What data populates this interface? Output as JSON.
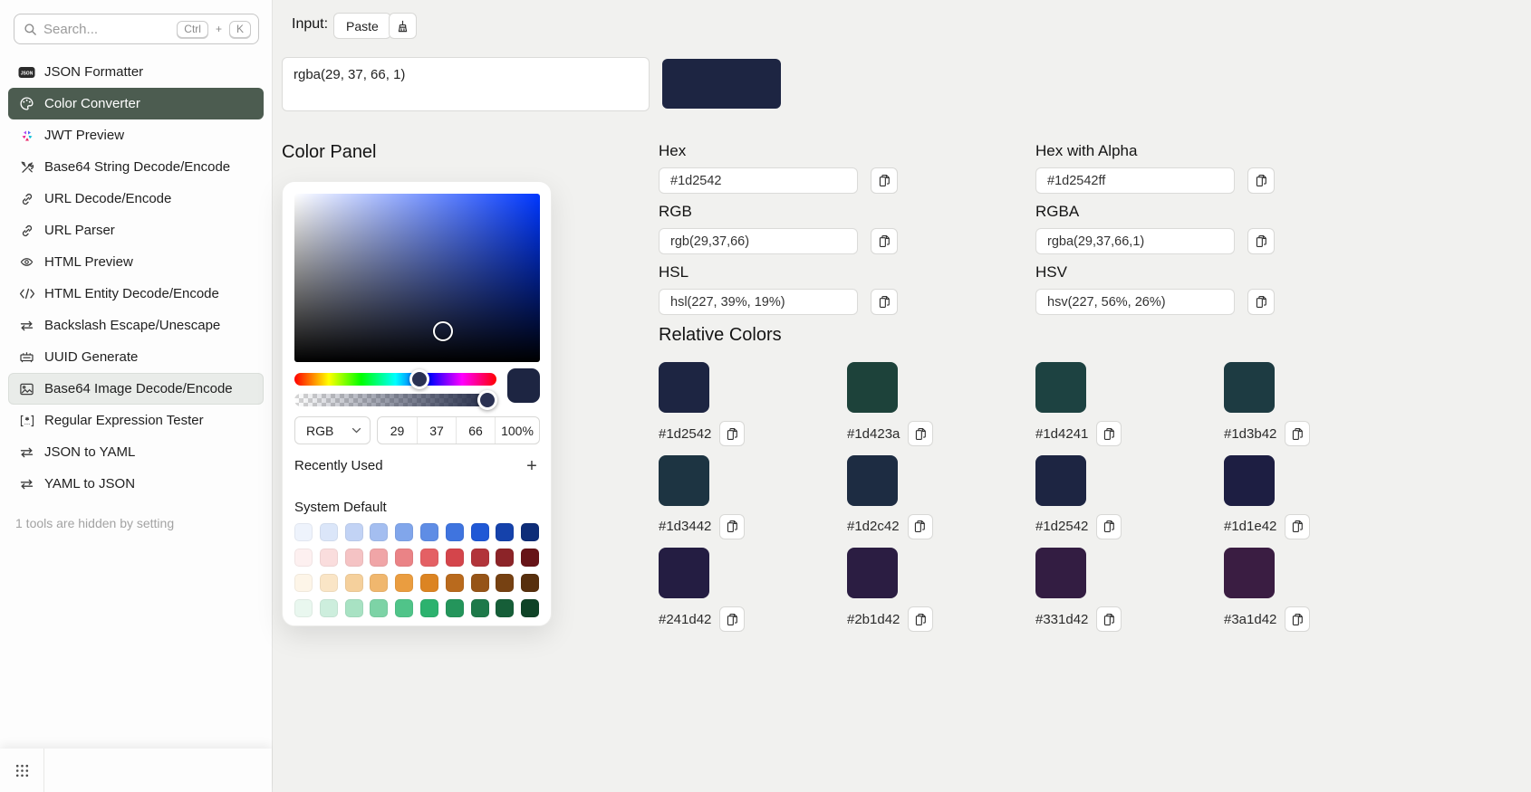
{
  "sidebar": {
    "search": {
      "placeholder": "Search...",
      "shortcut": {
        "key1": "Ctrl",
        "joiner": "+",
        "key2": "K"
      },
      "icon": "search-icon"
    },
    "items": [
      {
        "label": "JSON Formatter",
        "icon": "json-badge-icon",
        "state": "normal"
      },
      {
        "label": "Color Converter",
        "icon": "palette-icon",
        "state": "selected"
      },
      {
        "label": "JWT Preview",
        "icon": "jwt-pinwheel-icon",
        "state": "normal"
      },
      {
        "label": "Base64 String Decode/Encode",
        "icon": "hammer-wrench-icon",
        "state": "normal"
      },
      {
        "label": "URL Decode/Encode",
        "icon": "link-icon",
        "state": "normal"
      },
      {
        "label": "URL Parser",
        "icon": "link-icon",
        "state": "normal"
      },
      {
        "label": "HTML Preview",
        "icon": "eye-icon",
        "state": "normal"
      },
      {
        "label": "HTML Entity Decode/Encode",
        "icon": "code-brackets-icon",
        "state": "normal"
      },
      {
        "label": "Backslash Escape/Unescape",
        "icon": "swap-arrows-icon",
        "state": "normal"
      },
      {
        "label": "UUID Generate",
        "icon": "uuid-icon",
        "state": "normal"
      },
      {
        "label": "Base64 Image Decode/Encode",
        "icon": "image-icon",
        "state": "hover"
      },
      {
        "label": "Regular Expression Tester",
        "icon": "regex-icon",
        "state": "normal"
      },
      {
        "label": "JSON to YAML",
        "icon": "swap-arrows-icon",
        "state": "normal"
      },
      {
        "label": "YAML to JSON",
        "icon": "swap-arrows-icon",
        "state": "normal"
      }
    ],
    "hidden_note": "1 tools are hidden by setting",
    "footer_icon": "apps-grid-icon"
  },
  "main": {
    "input_bar": {
      "label": "Input:",
      "paste_label": "Paste",
      "clear_icon": "broom-icon"
    },
    "input_value": "rgba(29, 37, 66, 1)",
    "preview_color": "#1d2542",
    "color_panel": {
      "title": "Color Panel",
      "hue_color": "#0037ff",
      "thumb_color": "#2a3152",
      "format": "RGB",
      "channels": {
        "r": "29",
        "g": "37",
        "b": "66",
        "alpha": "100%"
      },
      "recently_used_label": "Recently Used",
      "add_label": "+",
      "system_default_label": "System Default",
      "palette": [
        [
          "#eef3fc",
          "#dbe6f9",
          "#c2d3f5",
          "#a4bef0",
          "#81a6eb",
          "#5f8de5",
          "#3f74df",
          "#2058d5",
          "#1542ab",
          "#0e2d78"
        ],
        [
          "#fdf0f0",
          "#fadddd",
          "#f5c3c4",
          "#f0a5a7",
          "#ea8386",
          "#e46064",
          "#d4454b",
          "#b2343a",
          "#8c2428",
          "#671418"
        ],
        [
          "#fdf5e8",
          "#fae5c6",
          "#f5d09c",
          "#f0b76e",
          "#ea9d40",
          "#dc8422",
          "#b96a1d",
          "#965417",
          "#764112",
          "#572f0d"
        ],
        [
          "#e9f7ef",
          "#cdeedd",
          "#a8e2c3",
          "#7dd3a6",
          "#50c489",
          "#2cb26e",
          "#24955b",
          "#1d7949",
          "#165e38",
          "#0f4327"
        ]
      ]
    },
    "conversions": [
      {
        "label": "Hex",
        "value": "#1d2542"
      },
      {
        "label": "Hex with Alpha",
        "value": "#1d2542ff"
      },
      {
        "label": "RGB",
        "value": "rgb(29,37,66)"
      },
      {
        "label": "RGBA",
        "value": "rgba(29,37,66,1)"
      },
      {
        "label": "HSL",
        "value": "hsl(227, 39%, 19%)"
      },
      {
        "label": "HSV",
        "value": "hsv(227, 56%, 26%)"
      }
    ],
    "relative_colors": {
      "title": "Relative Colors",
      "swatches": [
        "#1d2542",
        "#1d423a",
        "#1d4241",
        "#1d3b42",
        "#1d3442",
        "#1d2c42",
        "#1d2542",
        "#1d1e42",
        "#241d42",
        "#2b1d42",
        "#331d42",
        "#3a1d42"
      ]
    }
  },
  "colors": {
    "accent_selected_item": "#4c5c50",
    "main_background": "#f1f1ef",
    "sidebar_background": "#fdfdfd"
  },
  "icons": {
    "search": "magnifier",
    "json_formatter": "json-badge",
    "color_converter": "palette",
    "jwt_preview": "colorful-pinwheel",
    "base64_string": "hammer-wrench",
    "url": "chain-link",
    "html_preview": "eye",
    "html_entity": "code-brackets",
    "escape": "swap-arrows",
    "uuid": "stamp-bench",
    "base64_image": "picture",
    "regex": "regex-brackets",
    "clear": "broom",
    "copy": "copy-pages",
    "select": "chevron-down",
    "add": "plus",
    "apps": "grid-of-dots"
  }
}
